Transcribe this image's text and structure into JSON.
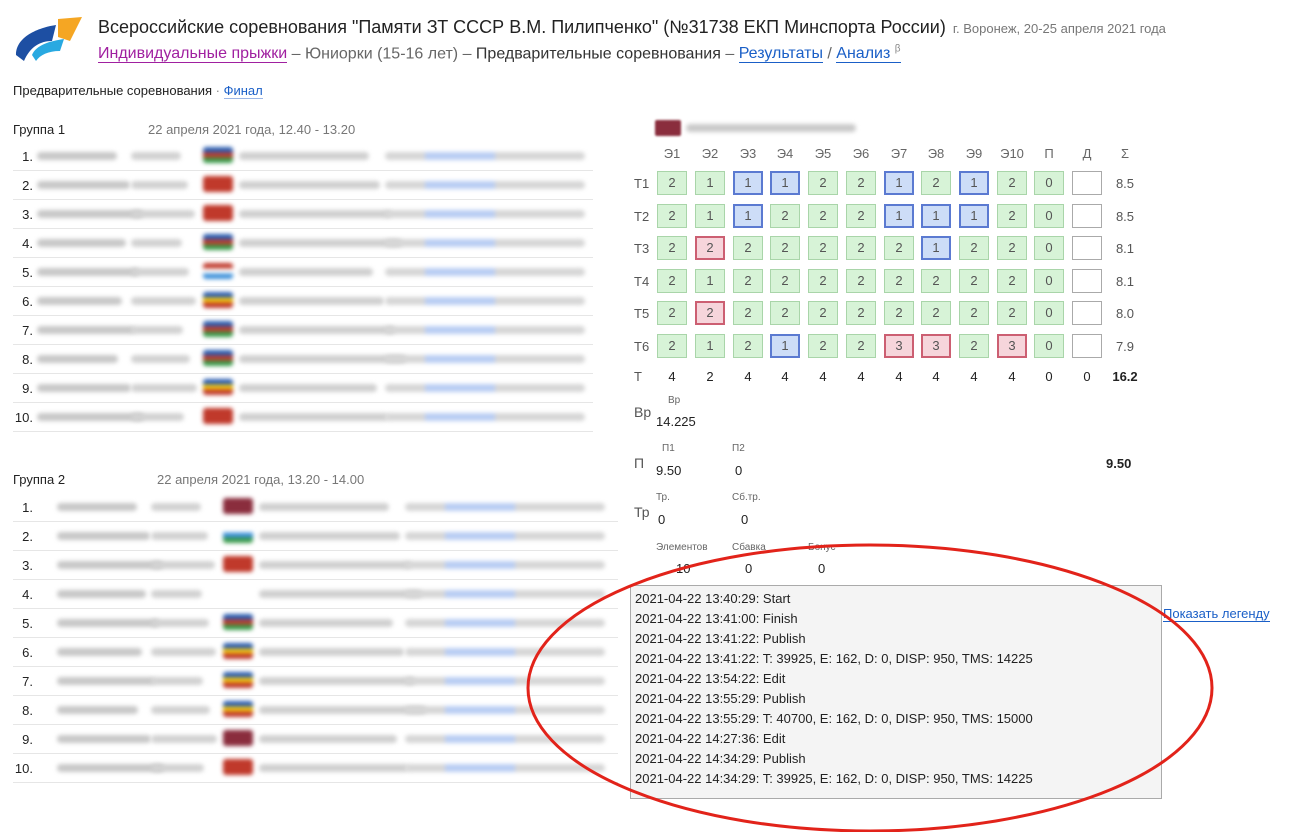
{
  "header": {
    "title": "Всероссийские соревнования \"Памяти ЗТ СССР В.М. Пилипченко\" (№31738 ЕКП Минспорта России)",
    "location": "г. Воронеж, 20-25 апреля 2021 года",
    "crumbs": {
      "discipline": "Индивидуальные прыжки",
      "sep1": " – ",
      "age": "Юниорки (15-16 лет)",
      "sep2": " – ",
      "stage": "Предварительные соревнования",
      "sep3": " – ",
      "results": "Результаты",
      "sep4": " / ",
      "analysis": "Анализ",
      "beta": "β"
    }
  },
  "subtabs": {
    "current": "Предварительные соревнования",
    "sep": " · ",
    "final": "Финал"
  },
  "group1": {
    "title": "Группа 1",
    "date": "22 апреля 2021 года, 12.40 - 13.20",
    "nums": [
      "1.",
      "2.",
      "3.",
      "4.",
      "5.",
      "6.",
      "7.",
      "8.",
      "9.",
      "10."
    ]
  },
  "group2": {
    "title": "Группа 2",
    "date": "22 апреля 2021 года, 13.20 - 14.00",
    "nums": [
      "1.",
      "2.",
      "3.",
      "4.",
      "5.",
      "6.",
      "7.",
      "8.",
      "9.",
      "10."
    ]
  },
  "scores": {
    "headers": [
      "Э1",
      "Э2",
      "Э3",
      "Э4",
      "Э5",
      "Э6",
      "Э7",
      "Э8",
      "Э9",
      "Э10",
      "П",
      "Д",
      "Σ"
    ],
    "rows": [
      {
        "label": "Т1",
        "values": [
          "2",
          "1",
          "1",
          "1",
          "2",
          "2",
          "1",
          "2",
          "1",
          "2",
          "0",
          ""
        ],
        "styles": [
          "g",
          "g",
          "b",
          "b",
          "g",
          "g",
          "b",
          "g",
          "b",
          "g",
          "g",
          "e"
        ],
        "sum": "8.5"
      },
      {
        "label": "Т2",
        "values": [
          "2",
          "1",
          "1",
          "2",
          "2",
          "2",
          "1",
          "1",
          "1",
          "2",
          "0",
          ""
        ],
        "styles": [
          "g",
          "g",
          "b",
          "g",
          "g",
          "g",
          "b",
          "b",
          "b",
          "g",
          "g",
          "e"
        ],
        "sum": "8.5"
      },
      {
        "label": "Т3",
        "values": [
          "2",
          "2",
          "2",
          "2",
          "2",
          "2",
          "2",
          "1",
          "2",
          "2",
          "0",
          ""
        ],
        "styles": [
          "g",
          "r",
          "g",
          "g",
          "g",
          "g",
          "g",
          "b",
          "g",
          "g",
          "g",
          "e"
        ],
        "sum": "8.1"
      },
      {
        "label": "Т4",
        "values": [
          "2",
          "1",
          "2",
          "2",
          "2",
          "2",
          "2",
          "2",
          "2",
          "2",
          "0",
          ""
        ],
        "styles": [
          "g",
          "g",
          "g",
          "g",
          "g",
          "g",
          "g",
          "g",
          "g",
          "g",
          "g",
          "e"
        ],
        "sum": "8.1"
      },
      {
        "label": "Т5",
        "values": [
          "2",
          "2",
          "2",
          "2",
          "2",
          "2",
          "2",
          "2",
          "2",
          "2",
          "0",
          ""
        ],
        "styles": [
          "g",
          "r",
          "g",
          "g",
          "g",
          "g",
          "g",
          "g",
          "g",
          "g",
          "g",
          "e"
        ],
        "sum": "8.0"
      },
      {
        "label": "Т6",
        "values": [
          "2",
          "1",
          "2",
          "1",
          "2",
          "2",
          "3",
          "3",
          "2",
          "3",
          "0",
          ""
        ],
        "styles": [
          "g",
          "g",
          "g",
          "b",
          "g",
          "g",
          "r",
          "r",
          "g",
          "r",
          "g",
          "e"
        ],
        "sum": "7.9"
      }
    ],
    "total": {
      "label": "Т",
      "values": [
        "4",
        "2",
        "4",
        "4",
        "4",
        "4",
        "4",
        "4",
        "4",
        "4",
        "0",
        "0"
      ],
      "sum": "16.2"
    }
  },
  "time": {
    "label": "Вр",
    "sub": "Вр",
    "value": "14.225"
  },
  "penalty": {
    "label": "П",
    "p1_label": "П1",
    "p1": "9.50",
    "p2_label": "П2",
    "p2": "0",
    "sum": "9.50"
  },
  "tramp": {
    "label": "Тр",
    "tr_label": "Тр.",
    "tr": "0",
    "sbtr_label": "Сб.тр.",
    "sbtr": "0"
  },
  "extra": {
    "el_label": "Элементов",
    "el": "10",
    "sb_label": "Сбавка",
    "sb": "0",
    "bonus_label": "Бонус",
    "bonus": "0"
  },
  "log": [
    "2021-04-22 13:40:29: Start",
    "2021-04-22 13:41:00: Finish",
    "2021-04-22 13:41:22: Publish",
    "2021-04-22 13:41:22: T: 39925, E: 162, D: 0, DISP: 950, TMS: 14225",
    "2021-04-22 13:54:22: Edit",
    "2021-04-22 13:55:29: Publish",
    "2021-04-22 13:55:29: T: 40700, E: 162, D: 0, DISP: 950, TMS: 15000",
    "2021-04-22 14:27:36: Edit",
    "2021-04-22 14:34:29: Publish",
    "2021-04-22 14:34:29: T: 39925, E: 162, D: 0, DISP: 950, TMS: 14225"
  ],
  "legend_link": "Показать легенду",
  "colors": {
    "link": "#1a5fc7",
    "discipline": "#a020a0",
    "green": "#d7f3d7",
    "blue": "#cdddf7",
    "red": "#f6d5db",
    "annotation": "#e2231a"
  }
}
